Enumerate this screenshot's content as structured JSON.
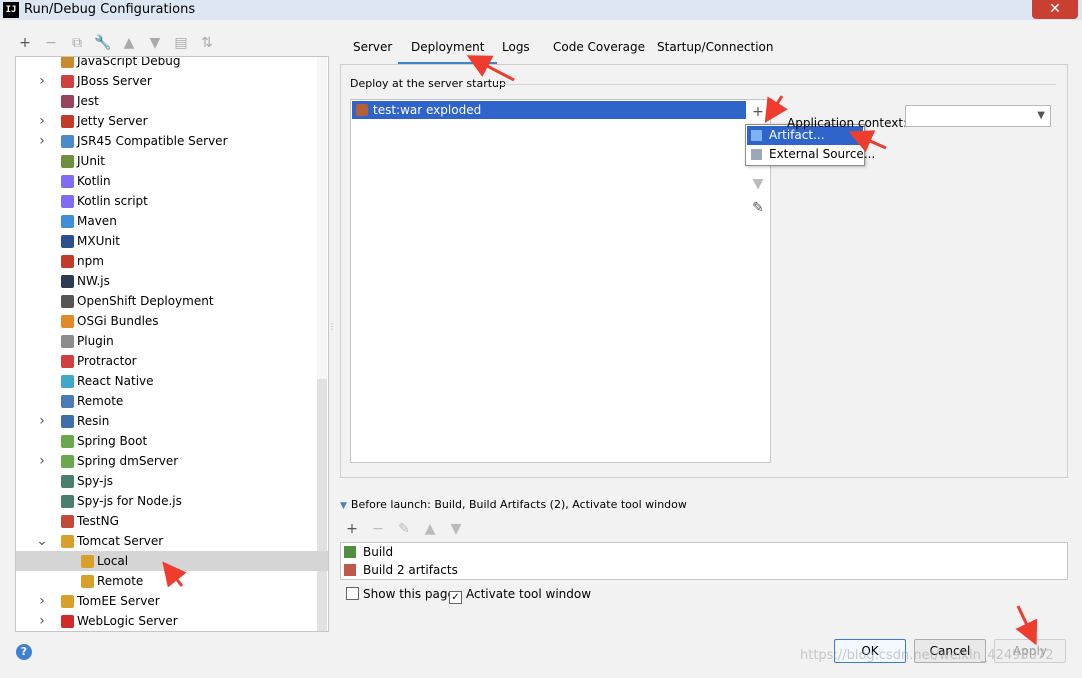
{
  "window": {
    "title": "Run/Debug Configurations",
    "app_icon_text": "IJ",
    "close_symbol": "✕"
  },
  "left_toolbar": [
    {
      "name": "add-button",
      "symbol": "+"
    },
    {
      "name": "remove-button",
      "symbol": "−"
    },
    {
      "name": "copy-button",
      "symbol": "⧉"
    },
    {
      "name": "edit-defaults-button",
      "symbol": "🔧"
    },
    {
      "name": "move-up-button",
      "symbol": "▲"
    },
    {
      "name": "move-down-button",
      "symbol": "▼"
    },
    {
      "name": "folder-button",
      "symbol": "▤"
    },
    {
      "name": "sort-button",
      "symbol": "⇅"
    }
  ],
  "tree": {
    "items": [
      {
        "label": "JavaScript Debug",
        "expandable": false,
        "level": 1,
        "icon": "javascript-debug-icon",
        "color": "#c98a2c"
      },
      {
        "label": "JBoss Server",
        "expandable": true,
        "level": 1,
        "icon": "jboss-icon",
        "color": "#d04040"
      },
      {
        "label": "Jest",
        "expandable": false,
        "level": 1,
        "icon": "jest-icon",
        "color": "#99425b"
      },
      {
        "label": "Jetty Server",
        "expandable": true,
        "level": 1,
        "icon": "jetty-icon",
        "color": "#c23a2a"
      },
      {
        "label": "JSR45 Compatible Server",
        "expandable": true,
        "level": 1,
        "icon": "jsr45-icon",
        "color": "#4c8ac9"
      },
      {
        "label": "JUnit",
        "expandable": false,
        "level": 1,
        "icon": "junit-icon",
        "color": "#6f8f3f"
      },
      {
        "label": "Kotlin",
        "expandable": false,
        "level": 1,
        "icon": "kotlin-icon",
        "color": "#7f6cf0"
      },
      {
        "label": "Kotlin script",
        "expandable": false,
        "level": 1,
        "icon": "kotlin-script-icon",
        "color": "#7f6cf0"
      },
      {
        "label": "Maven",
        "expandable": false,
        "level": 1,
        "icon": "maven-icon",
        "color": "#3f8fd8"
      },
      {
        "label": "MXUnit",
        "expandable": false,
        "level": 1,
        "icon": "mxunit-icon",
        "color": "#2d4f90"
      },
      {
        "label": "npm",
        "expandable": false,
        "level": 1,
        "icon": "npm-icon",
        "color": "#c23a2a"
      },
      {
        "label": "NW.js",
        "expandable": false,
        "level": 1,
        "icon": "nwjs-icon",
        "color": "#2d3b52"
      },
      {
        "label": "OpenShift Deployment",
        "expandable": false,
        "level": 1,
        "icon": "openshift-icon",
        "color": "#555555"
      },
      {
        "label": "OSGi Bundles",
        "expandable": false,
        "level": 1,
        "icon": "osgi-icon",
        "color": "#e08a2a"
      },
      {
        "label": "Plugin",
        "expandable": false,
        "level": 1,
        "icon": "plugin-icon",
        "color": "#8c8c8c"
      },
      {
        "label": "Protractor",
        "expandable": false,
        "level": 1,
        "icon": "protractor-icon",
        "color": "#d04040"
      },
      {
        "label": "React Native",
        "expandable": false,
        "level": 1,
        "icon": "react-icon",
        "color": "#3fa8c8"
      },
      {
        "label": "Remote",
        "expandable": false,
        "level": 1,
        "icon": "remote-icon",
        "color": "#4c7ab8"
      },
      {
        "label": "Resin",
        "expandable": true,
        "level": 1,
        "icon": "resin-icon",
        "color": "#3f6fa8"
      },
      {
        "label": "Spring Boot",
        "expandable": false,
        "level": 1,
        "icon": "spring-boot-icon",
        "color": "#6aa84f"
      },
      {
        "label": "Spring dmServer",
        "expandable": true,
        "level": 1,
        "icon": "spring-dm-icon",
        "color": "#6aa84f"
      },
      {
        "label": "Spy-js",
        "expandable": false,
        "level": 1,
        "icon": "spyjs-icon",
        "color": "#4a7f6f"
      },
      {
        "label": "Spy-js for Node.js",
        "expandable": false,
        "level": 1,
        "icon": "spyjs-node-icon",
        "color": "#4a7f6f"
      },
      {
        "label": "TestNG",
        "expandable": false,
        "level": 1,
        "icon": "testng-icon",
        "color": "#c24a3a"
      },
      {
        "label": "Tomcat Server",
        "expandable": true,
        "expanded": true,
        "level": 1,
        "icon": "tomcat-icon",
        "color": "#d8a02a"
      },
      {
        "label": "Local",
        "expandable": false,
        "level": 2,
        "icon": "tomcat-local-icon",
        "color": "#d8a02a",
        "selected": true
      },
      {
        "label": "Remote",
        "expandable": false,
        "level": 2,
        "icon": "tomcat-remote-icon",
        "color": "#d8a02a"
      },
      {
        "label": "TomEE Server",
        "expandable": true,
        "level": 1,
        "icon": "tomee-icon",
        "color": "#d8a02a"
      },
      {
        "label": "WebLogic Server",
        "expandable": true,
        "level": 1,
        "icon": "weblogic-icon",
        "color": "#d02a2a"
      }
    ]
  },
  "tabs": [
    "Server",
    "Deployment",
    "Logs",
    "Code Coverage",
    "Startup/Connection"
  ],
  "active_tab": "Deployment",
  "deployment": {
    "group_title": "Deploy at the server startup",
    "artifacts": [
      "test:war exploded"
    ],
    "side_tools": [
      {
        "name": "add-artifact-button",
        "symbol": "+"
      },
      {
        "name": "remove-artifact-button",
        "symbol": "−"
      },
      {
        "name": "move-up-artifact-button",
        "symbol": "▲"
      },
      {
        "name": "move-down-artifact-button",
        "symbol": "▼"
      },
      {
        "name": "edit-artifact-button",
        "symbol": "✎"
      }
    ],
    "popup": [
      {
        "label": "Artifact...",
        "icon": "artifact-icon",
        "selected": true
      },
      {
        "label": "External Source...",
        "icon": "external-source-icon",
        "selected": false
      }
    ],
    "app_context_label": "Application context:",
    "app_context_value": ""
  },
  "before_launch": {
    "title": "Before launch: Build, Build Artifacts (2), Activate tool window",
    "toolbar": [
      "+",
      "−",
      "✎",
      "▲",
      "▼"
    ],
    "items": [
      {
        "label": "Build",
        "icon": "build-hammer-icon"
      },
      {
        "label": "Build 2 artifacts",
        "icon": "build-artifacts-icon"
      }
    ],
    "show_this_page": {
      "label": "Show this page",
      "checked": false
    },
    "activate_tool_window": {
      "label": "Activate tool window",
      "checked": true
    }
  },
  "buttons": {
    "ok": "OK",
    "cancel": "Cancel",
    "apply": "Apply"
  },
  "help_symbol": "?",
  "watermark": "https://blog.csdn.net/weixin_42493072",
  "colors": {
    "accent": "#2f65ca",
    "arrow": "#f03c2e"
  }
}
